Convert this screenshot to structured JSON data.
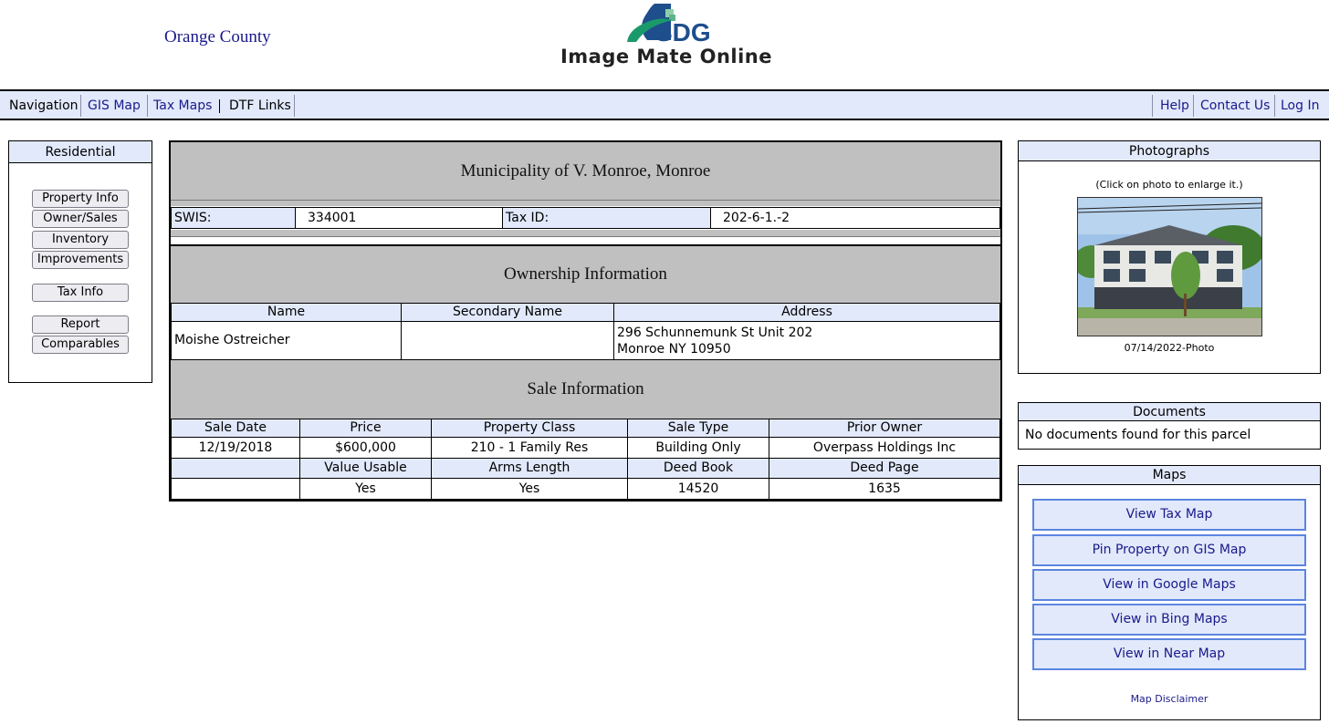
{
  "header": {
    "county": "Orange County",
    "logo_text": "SDG",
    "product_title": "Image Mate Online"
  },
  "nav": {
    "navigation": "Navigation",
    "gis_map": "GIS Map",
    "tax_maps": "Tax Maps",
    "dtf_links": "DTF Links",
    "help": "Help",
    "contact_us": "Contact Us",
    "log_in": "Log In"
  },
  "sidebar": {
    "title": "Residential",
    "buttons": [
      "Property Info",
      "Owner/Sales",
      "Inventory",
      "Improvements",
      "Tax Info",
      "Report",
      "Comparables"
    ]
  },
  "main": {
    "municipality": "Municipality of V. Monroe, Monroe",
    "swis_label": "SWIS:",
    "swis_value": "334001",
    "taxid_label": "Tax ID:",
    "taxid_value": "202-6-1.-2",
    "ownership_title": "Ownership Information",
    "ownership_headers": [
      "Name",
      "Secondary Name",
      "Address"
    ],
    "owner_name": "Moishe Ostreicher",
    "owner_secondary": "",
    "owner_address_line1": "296 Schunnemunk St Unit 202",
    "owner_address_line2": "Monroe NY 10950",
    "sale_title": "Sale Information",
    "sale_headers1": [
      "Sale Date",
      "Price",
      "Property Class",
      "Sale Type",
      "Prior Owner"
    ],
    "sale_row1": [
      "12/19/2018",
      "$600,000",
      "210 - 1 Family Res",
      "Building Only",
      "Overpass Holdings Inc"
    ],
    "sale_headers2": [
      "",
      "Value Usable",
      "Arms Length",
      "Deed Book",
      "Deed Page"
    ],
    "sale_row2": [
      "",
      "Yes",
      "Yes",
      "14520",
      "1635"
    ]
  },
  "photos": {
    "title": "Photographs",
    "hint": "(Click on photo to enlarge it.)",
    "caption": "07/14/2022-Photo"
  },
  "documents": {
    "title": "Documents",
    "message": "No documents found for this parcel"
  },
  "maps": {
    "title": "Maps",
    "buttons": [
      "View Tax Map",
      "Pin Property on GIS Map",
      "View in Google Maps",
      "View in Bing Maps",
      "View in Near Map"
    ],
    "disclaimer": "Map Disclaimer"
  },
  "colors": {
    "accent_bg": "#e1e9fb",
    "link": "#1a1a8a",
    "band": "#c0c0c0",
    "map_button_border": "#5b85e0",
    "logo_blue": "#1f4e8c",
    "logo_green": "#1a9a6a"
  }
}
